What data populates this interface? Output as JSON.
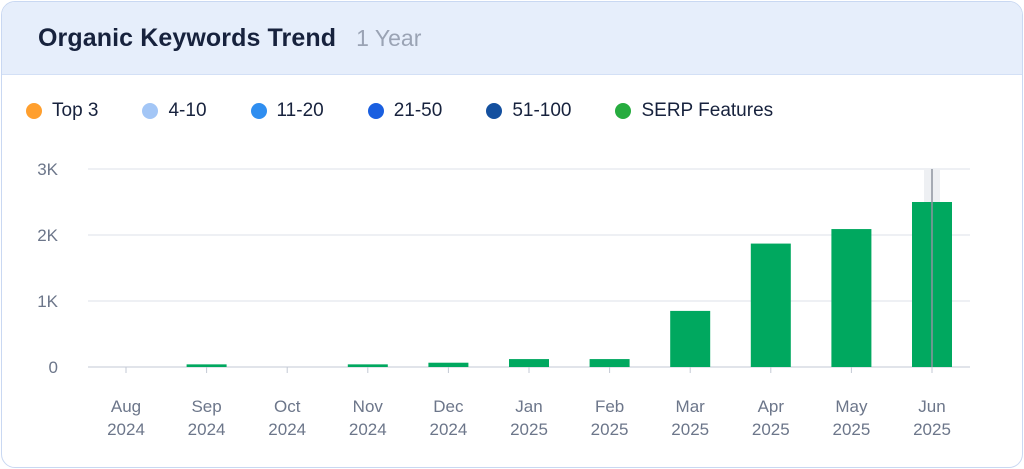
{
  "header": {
    "title": "Organic Keywords Trend",
    "period": "1 Year"
  },
  "legend": [
    {
      "label": "Top 3",
      "color": "#ff9f2e"
    },
    {
      "label": "4-10",
      "color": "#a3c6f6"
    },
    {
      "label": "11-20",
      "color": "#2f8ef0"
    },
    {
      "label": "21-50",
      "color": "#1a5fe0"
    },
    {
      "label": "51-100",
      "color": "#14509f"
    },
    {
      "label": "SERP Features",
      "color": "#27ac3f"
    }
  ],
  "chart_data": {
    "type": "bar",
    "categories": [
      [
        "Aug",
        "2024"
      ],
      [
        "Sep",
        "2024"
      ],
      [
        "Oct",
        "2024"
      ],
      [
        "Nov",
        "2024"
      ],
      [
        "Dec",
        "2024"
      ],
      [
        "Jan",
        "2025"
      ],
      [
        "Feb",
        "2025"
      ],
      [
        "Mar",
        "2025"
      ],
      [
        "Apr",
        "2025"
      ],
      [
        "May",
        "2025"
      ],
      [
        "Jun",
        "2025"
      ]
    ],
    "values": [
      0,
      40,
      0,
      40,
      65,
      120,
      120,
      850,
      1870,
      2090,
      2500
    ],
    "y_ticks": [
      "0",
      "1K",
      "2K",
      "3K"
    ],
    "ylim": [
      0,
      3000
    ],
    "bar_color": "#00a85f",
    "grid": true,
    "highlight_index": 10
  }
}
